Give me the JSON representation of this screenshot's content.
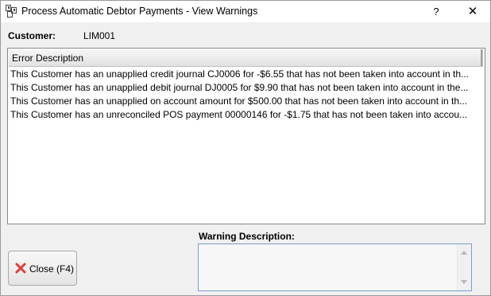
{
  "window": {
    "title": "Process Automatic Debtor Payments - View Warnings",
    "help_label": "?",
    "close_label": "✕"
  },
  "customer": {
    "label": "Customer:",
    "value": "LIM001"
  },
  "grid": {
    "column_header": "Error Description",
    "rows": [
      "This Customer has an unapplied credit journal CJ0006 for -$6.55 that has not been taken into account in th...",
      "This Customer has an unapplied debit journal DJ0005 for $9.90 that has not been taken into account in the...",
      "This Customer has an unapplied on account amount for $500.00 that has not been taken into account in th...",
      "This Customer has an unreconciled POS payment 00000146 for -$1.75 that has not been taken into accou..."
    ]
  },
  "warning": {
    "label": "Warning Description:",
    "value": ""
  },
  "buttons": {
    "close_label": "Close (F4)"
  },
  "colors": {
    "accent_border": "#7a9cd0",
    "close_icon": "#e03c3c"
  }
}
